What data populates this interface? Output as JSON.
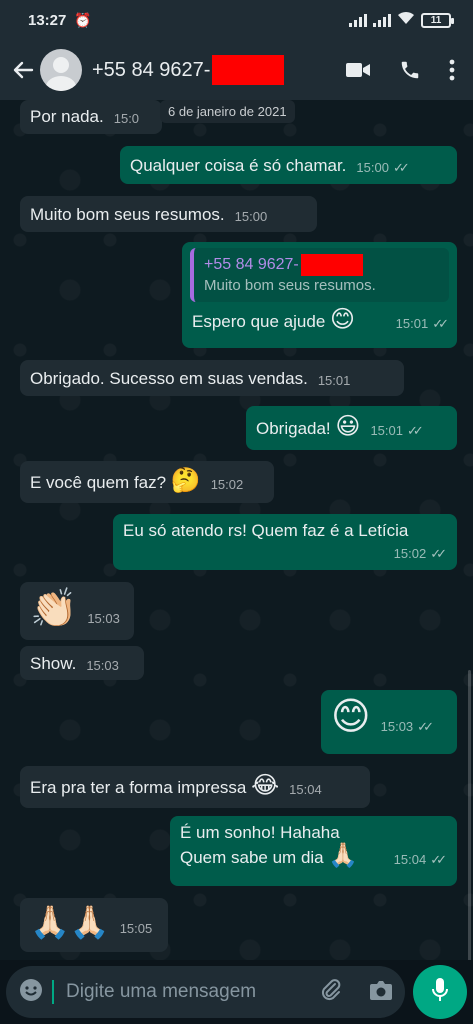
{
  "status_bar": {
    "time": "13:27",
    "battery": "11"
  },
  "header": {
    "contact": "+55 84 9627-"
  },
  "date_chip": "6 de janeiro de 2021",
  "messages": [
    {
      "dir": "in",
      "text": "Por nada.",
      "time": "15:0"
    },
    {
      "dir": "out",
      "text": "Qualquer coisa é só chamar.",
      "time": "15:00"
    },
    {
      "dir": "in",
      "text": "Muito bom seus resumos.",
      "time": "15:00"
    },
    {
      "dir": "out",
      "quote_name": "+55 84 9627-",
      "quote_text": "Muito bom seus resumos.",
      "text": "Espero que ajude",
      "emoji": "😊",
      "time": "15:01"
    },
    {
      "dir": "in",
      "text": "Obrigado. Sucesso em suas vendas.",
      "time": "15:01"
    },
    {
      "dir": "out",
      "text": "Obrigada!",
      "emoji": "😃",
      "time": "15:01"
    },
    {
      "dir": "in",
      "text": "E você quem faz?",
      "emoji": "🤔",
      "time": "15:02"
    },
    {
      "dir": "out",
      "text": "Eu só atendo rs! Quem faz é a Letícia",
      "time": "15:02"
    },
    {
      "dir": "in",
      "emoji": "👏🏻",
      "time": "15:03"
    },
    {
      "dir": "in",
      "text": "Show.",
      "time": "15:03"
    },
    {
      "dir": "out",
      "emoji": "😊",
      "time": "15:03"
    },
    {
      "dir": "in",
      "text": "Era pra ter a forma impressa",
      "emoji": "😂",
      "time": "15:04"
    },
    {
      "dir": "out",
      "text": "É um sonho! Hahaha",
      "text2": "Quem sabe um dia",
      "emoji": "🙏🏻",
      "time": "15:04"
    },
    {
      "dir": "in",
      "emoji": "🙏🏻🙏🏻",
      "time": "15:05"
    }
  ],
  "composer": {
    "placeholder": "Digite uma mensagem"
  },
  "icons": {
    "back": "arrow-left",
    "video": "video-camera",
    "call": "phone",
    "menu": "more-vertical",
    "emoji": "emoji-face",
    "attach": "paperclip",
    "camera": "camera",
    "mic": "microphone"
  },
  "colors": {
    "incoming": "#202c33",
    "outgoing": "#005c4b",
    "accent": "#00a884",
    "redaction": "#ff0000"
  }
}
